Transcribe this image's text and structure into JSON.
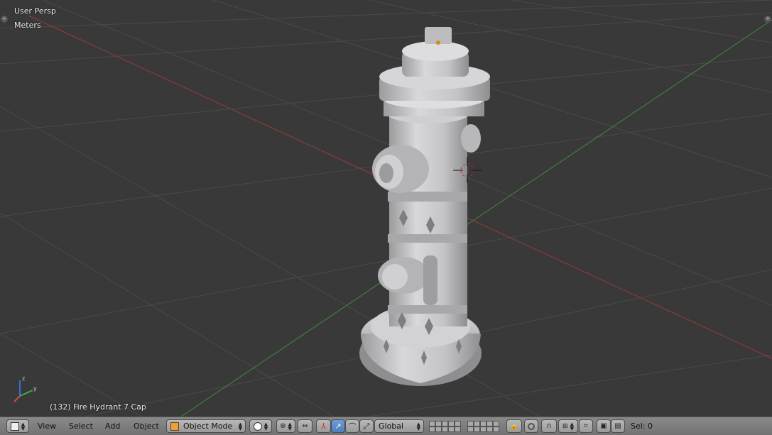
{
  "viewport": {
    "view_label": "User Persp",
    "units_label": "Meters",
    "object_label": "(132) Fire Hydrant 7 Cap",
    "grid_color": "#4a4a4a",
    "x_axis_color": "#9a3a3a",
    "y_axis_color": "#3f8a3f",
    "background_color": "#393939",
    "model_color": "#c9c9cb"
  },
  "header": {
    "editor_type_icon": "3d-view-cube-icon",
    "menus": {
      "view": "View",
      "select": "Select",
      "add": "Add",
      "object": "Object"
    },
    "mode": "Object Mode",
    "orientation": "Global",
    "selection_count": "Sel: 0"
  }
}
